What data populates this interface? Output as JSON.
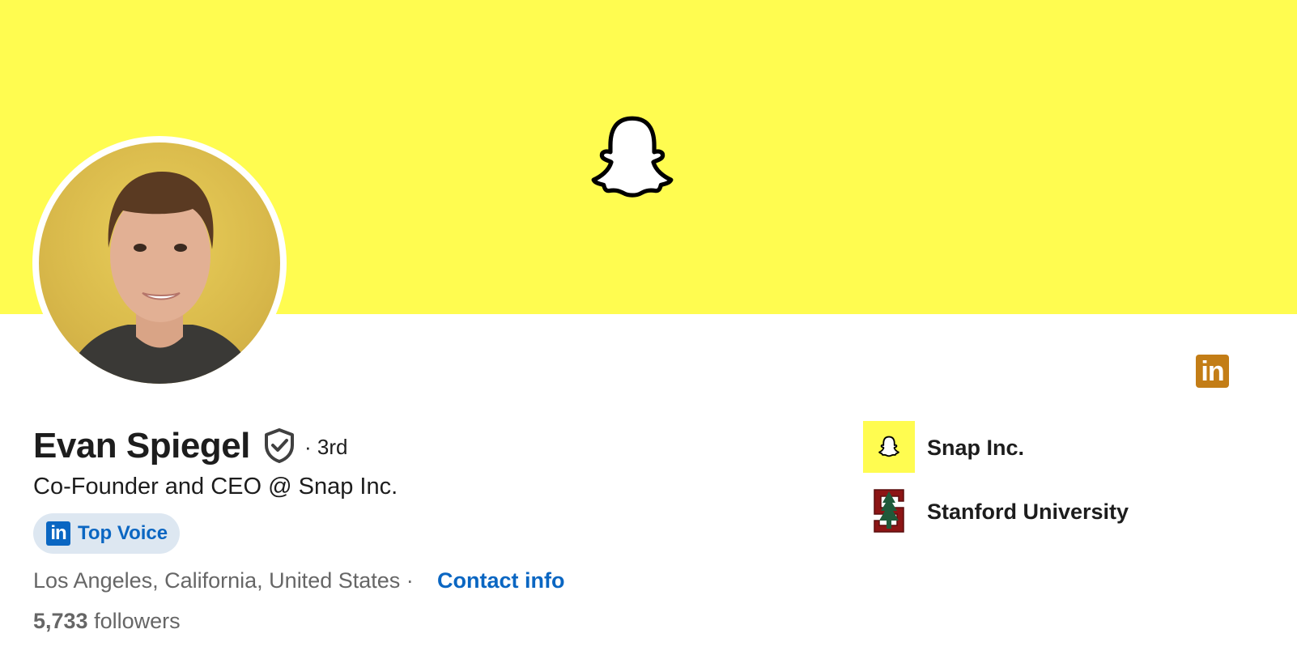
{
  "profile": {
    "name": "Evan Spiegel",
    "degree": "· 3rd",
    "headline": "Co-Founder and CEO @ Snap Inc.",
    "badge": {
      "label": "Top Voice",
      "icon": "linkedin-icon"
    },
    "location": "Los Angeles, California, United States ·",
    "contact_label": "Contact info",
    "followers_count": "5,733",
    "followers_label": "followers"
  },
  "organizations": [
    {
      "name": "Snap Inc.",
      "icon": "snapchat-ghost-icon"
    },
    {
      "name": "Stanford University",
      "icon": "stanford-tree-icon"
    }
  ],
  "icons": {
    "banner": "snapchat-ghost-icon",
    "corner": "linkedin-icon",
    "verified": "verified-shield-icon"
  },
  "colors": {
    "banner": "#fffc50",
    "linkedin_blue": "#0a66c2",
    "corner_badge": "#c37d16",
    "stanford_red": "#8c1515"
  }
}
